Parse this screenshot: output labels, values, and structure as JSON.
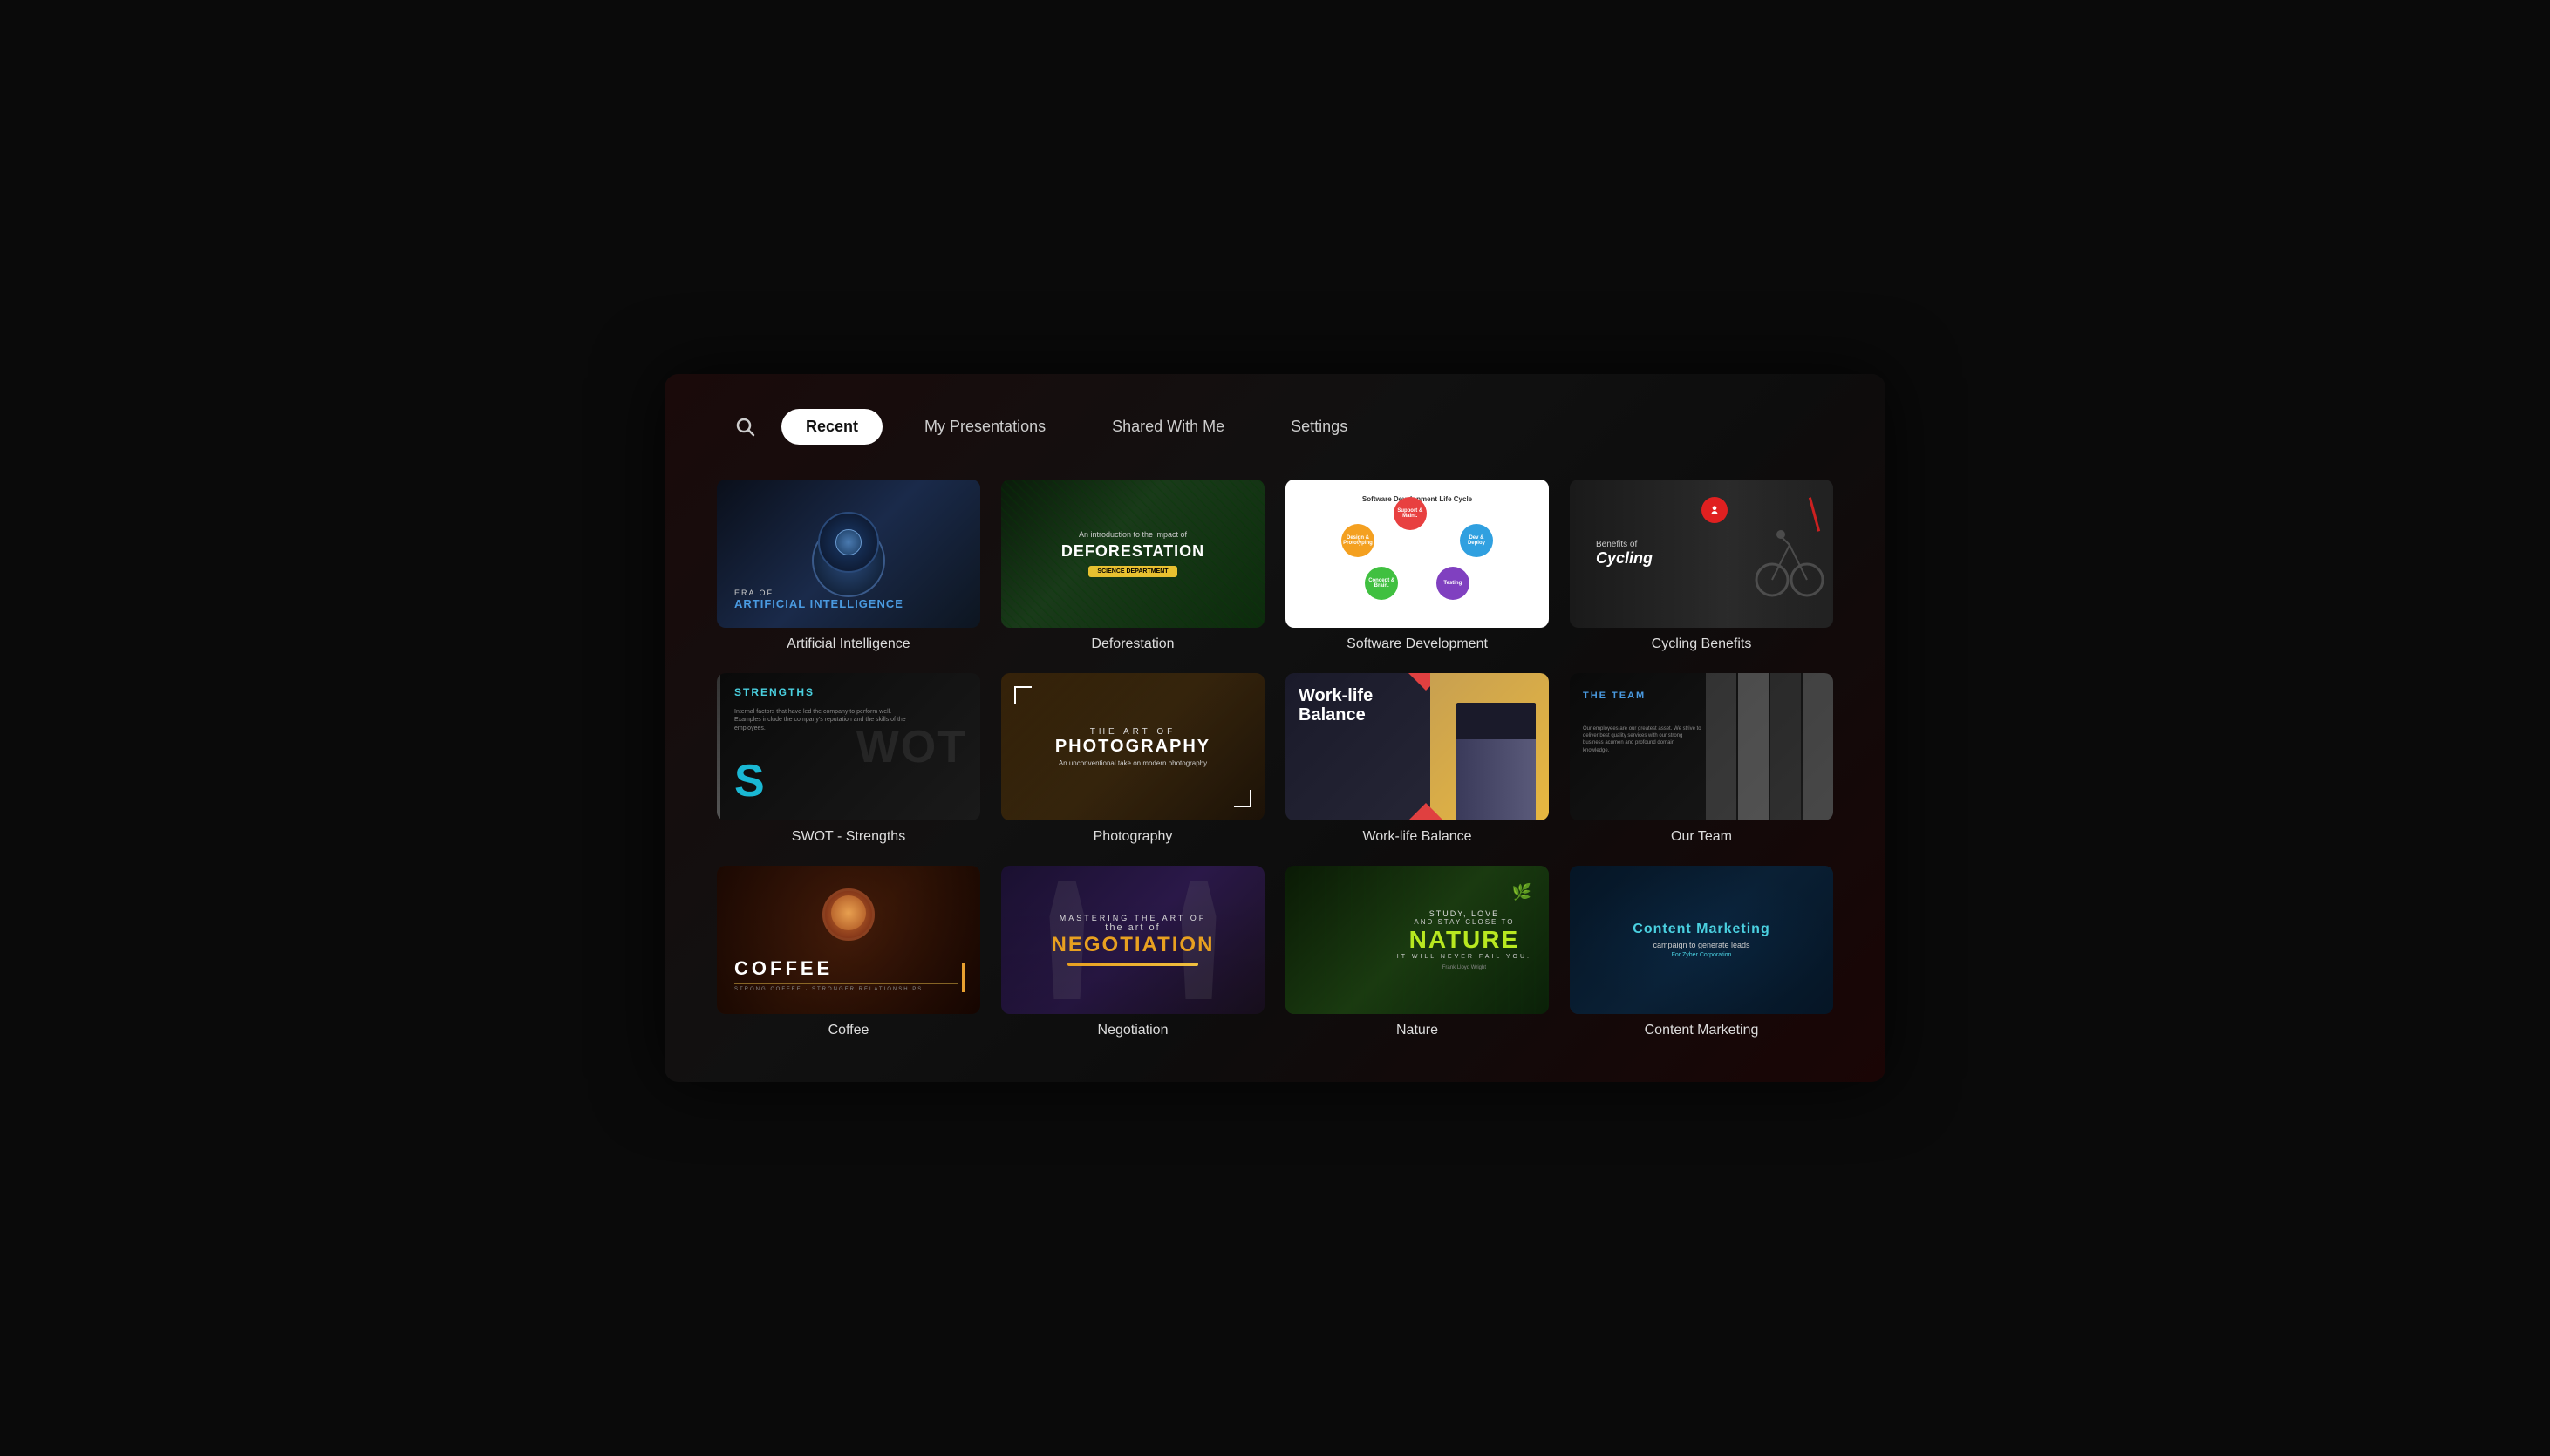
{
  "nav": {
    "search_icon": "🔍",
    "tabs": [
      {
        "id": "recent",
        "label": "Recent",
        "active": true
      },
      {
        "id": "my-presentations",
        "label": "My Presentations",
        "active": false
      },
      {
        "id": "shared-with-me",
        "label": "Shared With Me",
        "active": false
      },
      {
        "id": "settings",
        "label": "Settings",
        "active": false
      }
    ]
  },
  "presentations": [
    {
      "id": "ai",
      "label": "Artificial Intelligence",
      "thumb_type": "ai"
    },
    {
      "id": "deforestation",
      "label": "Deforestation",
      "thumb_type": "deforestation"
    },
    {
      "id": "software",
      "label": "Software Development",
      "thumb_type": "software"
    },
    {
      "id": "cycling",
      "label": "Cycling Benefits",
      "thumb_type": "cycling"
    },
    {
      "id": "swot",
      "label": "SWOT - Strengths",
      "thumb_type": "swot"
    },
    {
      "id": "photography",
      "label": "Photography",
      "thumb_type": "photography"
    },
    {
      "id": "worklife",
      "label": "Work-life Balance",
      "thumb_type": "worklife"
    },
    {
      "id": "ourteam",
      "label": "Our Team",
      "thumb_type": "ourteam"
    },
    {
      "id": "coffee",
      "label": "Coffee",
      "thumb_type": "coffee"
    },
    {
      "id": "negotiation",
      "label": "Negotiation",
      "thumb_type": "negotiation"
    },
    {
      "id": "nature",
      "label": "Nature",
      "thumb_type": "nature"
    },
    {
      "id": "content-marketing",
      "label": "Content Marketing",
      "thumb_type": "content"
    }
  ],
  "thumbnails": {
    "ai": {
      "era_of": "ERA OF",
      "title": "ARTIFICIAL INTELLIGENCE"
    },
    "deforestation": {
      "intro": "An introduction to the impact of",
      "title": "DEFORESTATION",
      "badge": "SCIENCE DEPARTMENT"
    },
    "software": {
      "title": "Software Development Life Cycle",
      "circles": [
        "Design & Prototyping",
        "Support & Maintenance",
        "Development & Deployment",
        "Concept & Brainstorming",
        "Testing"
      ]
    },
    "cycling": {
      "benefits": "Benefits of",
      "title": "Cycling"
    },
    "swot": {
      "label": "STRENGTHS",
      "desc": "Internal factors that have led the company to perform well. Examples include the company's reputation and the skills of the employees."
    },
    "photography": {
      "the": "THE ART OF",
      "title": "PHOTOGRAPHY",
      "sub": "An unconventional take on modern photography"
    },
    "worklife": {
      "title": "Work-life\nBalance"
    },
    "ourteam": {
      "title_top": "THE TEAM",
      "desc": "Our employees are our greatest asset. We strive to deliver best quality services with our strong business acumen and profound domain knowledge."
    },
    "coffee": {
      "title": "COFFEE",
      "sub": "STRONG COFFEE\nSTRONGER RELATIONSHIPS"
    },
    "negotiation": {
      "mastering": "Mastering the art of",
      "title": "NEGOTIATION"
    },
    "nature": {
      "study": "STUDY, LOVE",
      "stay": "AND STAY CLOSE TO",
      "title": "NATURE",
      "never": "IT WILL NEVER FAIL YOU.",
      "author": "Frank Lloyd Wright"
    },
    "content": {
      "title": "Content Marketing",
      "sub": "campaign to generate leads",
      "company": "For Zyber Corporation"
    }
  }
}
